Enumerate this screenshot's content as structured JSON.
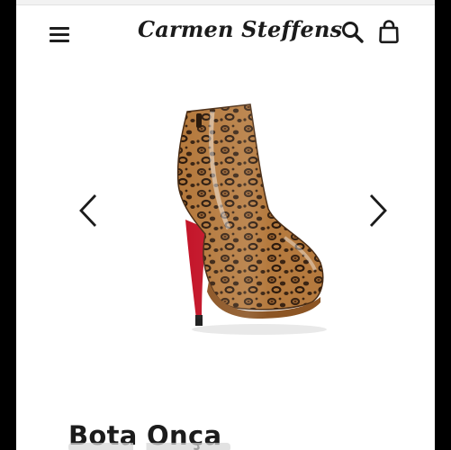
{
  "header": {
    "brand": "Carmen Steffens",
    "menu_icon": "hamburger-menu-icon",
    "search_icon": "search-icon",
    "bag_icon": "shopping-bag-icon"
  },
  "carousel": {
    "prev_icon": "chevron-left-icon",
    "next_icon": "chevron-right-icon",
    "image_alt": "leopard print patent ankle boot with red sole"
  },
  "product": {
    "title": "Bota Onça"
  },
  "colors": {
    "text": "#1c1c1c",
    "leopard_base": "#b57a3e",
    "leopard_spot": "#3a2413",
    "sole_red": "#c4162a",
    "frame": "#000000"
  }
}
